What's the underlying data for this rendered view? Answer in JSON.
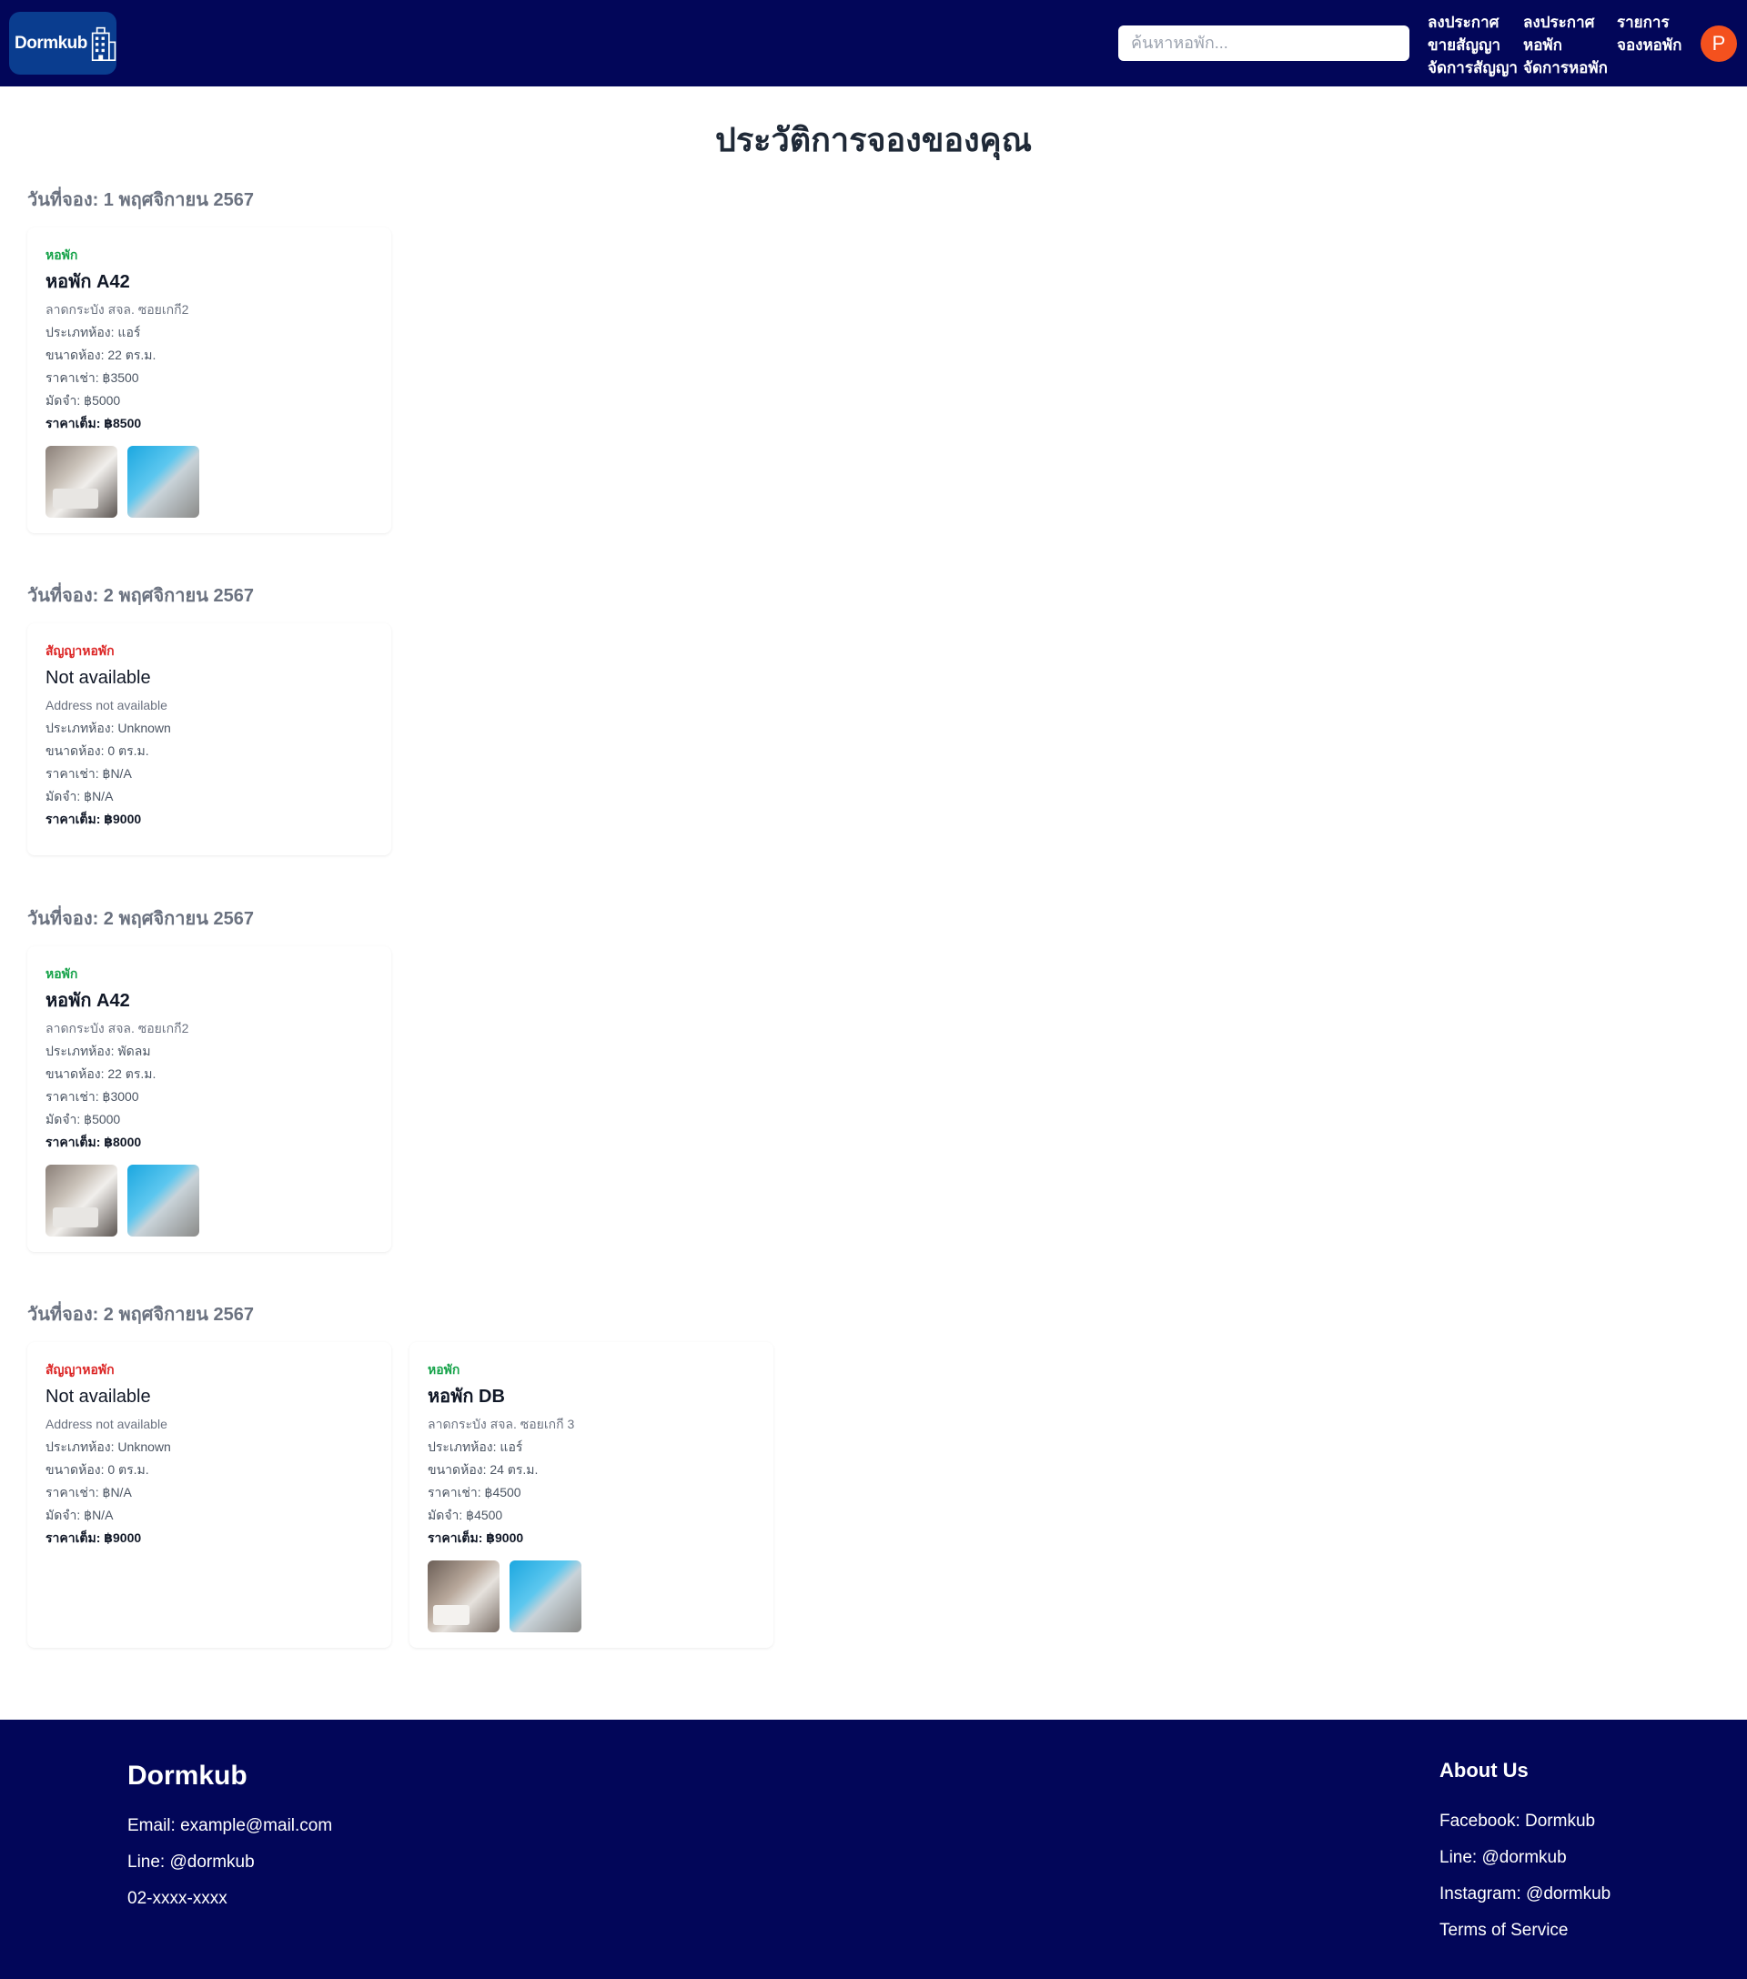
{
  "header": {
    "brand": "Dormkub",
    "search_placeholder": "ค้นหาหอพัก...",
    "nav": [
      {
        "line1": "ลงประกาศ",
        "line2": "ขายสัญญา",
        "line3": "จัดการสัญญา"
      },
      {
        "line1": "ลงประกาศ",
        "line2": "หอพัก",
        "line3": "จัดการหอพัก"
      },
      {
        "line1": "รายการ",
        "line2": "จองหอพัก"
      }
    ],
    "avatar_initial": "P"
  },
  "page_title": "ประวัติการจองของคุณ",
  "bookings": [
    {
      "date": "วันที่จอง: 1 พฤศจิกายน 2567",
      "cards": [
        {
          "type": "หอพัก",
          "name": "หอพัก A42",
          "address": "ลาดกระบัง สจล. ซอยเกกี2",
          "room_type": "ประเภทห้อง: แอร์",
          "size": "ขนาดห้อง: 22 ตร.ม.",
          "rent": "ราคาเช่า: ฿3500",
          "deposit": "มัดจำ: ฿5000",
          "total": "ราคาเต็ม: ฿8500"
        }
      ]
    },
    {
      "date": "วันที่จอง: 2 พฤศจิกายน 2567",
      "cards": [
        {
          "type": "สัญญาหอพัก",
          "name": "Not available",
          "address": "Address not available",
          "room_type": "ประเภทห้อง: Unknown",
          "size": "ขนาดห้อง: 0 ตร.ม.",
          "rent": "ราคาเช่า: ฿N/A",
          "deposit": "มัดจำ: ฿N/A",
          "total": "ราคาเต็ม: ฿9000"
        }
      ]
    },
    {
      "date": "วันที่จอง: 2 พฤศจิกายน 2567",
      "cards": [
        {
          "type": "หอพัก",
          "name": "หอพัก A42",
          "address": "ลาดกระบัง สจล. ซอยเกกี2",
          "room_type": "ประเภทห้อง: พัดลม",
          "size": "ขนาดห้อง: 22 ตร.ม.",
          "rent": "ราคาเช่า: ฿3000",
          "deposit": "มัดจำ: ฿5000",
          "total": "ราคาเต็ม: ฿8000"
        }
      ]
    },
    {
      "date": "วันที่จอง: 2 พฤศจิกายน 2567",
      "cards": [
        {
          "type": "สัญญาหอพัก",
          "name": "Not available",
          "address": "Address not available",
          "room_type": "ประเภทห้อง: Unknown",
          "size": "ขนาดห้อง: 0 ตร.ม.",
          "rent": "ราคาเช่า: ฿N/A",
          "deposit": "มัดจำ: ฿N/A",
          "total": "ราคาเต็ม: ฿9000"
        },
        {
          "type": "หอพัก",
          "name": "หอพัก DB",
          "address": "ลาดกระบัง สจล. ซอยเกกี 3",
          "room_type": "ประเภทห้อง: แอร์",
          "size": "ขนาดห้อง: 24 ตร.ม.",
          "rent": "ราคาเช่า: ฿4500",
          "deposit": "มัดจำ: ฿4500",
          "total": "ราคาเต็ม: ฿9000"
        }
      ]
    }
  ],
  "footer": {
    "brand": "Dormkub",
    "email": "Email: example@mail.com",
    "line": "Line: @dormkub",
    "phone": "02-xxxx-xxxx",
    "about_title": "About Us",
    "facebook": "Facebook: Dormkub",
    "about_line": "Line: @dormkub",
    "instagram": "Instagram: @dormkub",
    "terms": "Terms of Service"
  },
  "colors": {
    "navy": "#020659",
    "dorm_type": "#16a34a",
    "contract_type": "#dc2626",
    "avatar": "#f4511e"
  }
}
